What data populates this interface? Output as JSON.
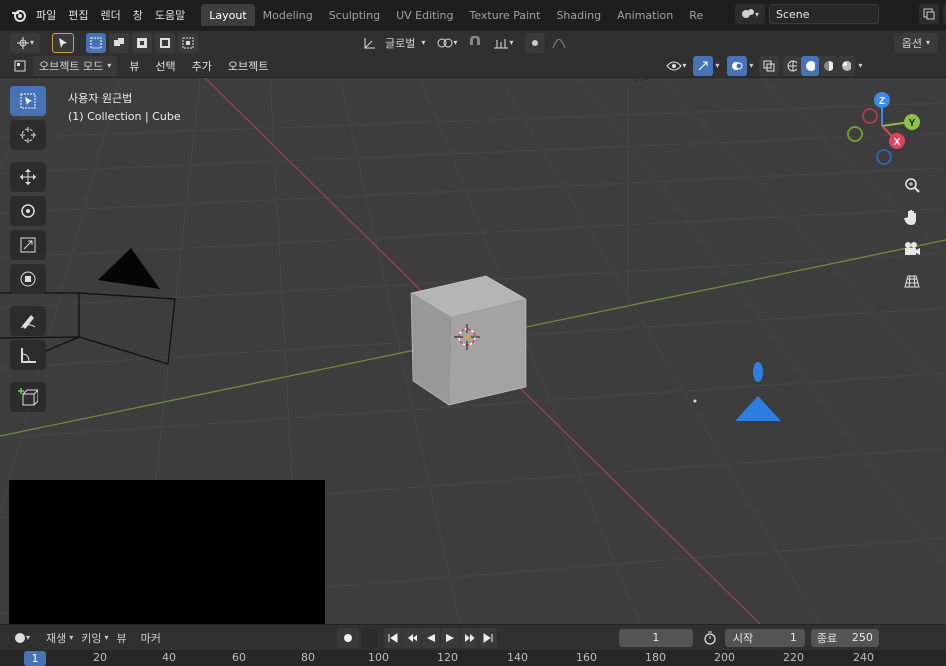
{
  "topbar": {
    "menus": [
      "파일",
      "편집",
      "렌더",
      "창",
      "도움말"
    ],
    "workspaces": [
      "Layout",
      "Modeling",
      "Sculpting",
      "UV Editing",
      "Texture Paint",
      "Shading",
      "Animation",
      "Re"
    ],
    "active_workspace": "Layout",
    "scene_name": "Scene"
  },
  "header": {
    "transform_orientation": "글로벌",
    "options_label": "옵션",
    "mode_label": "오브젝트 모드",
    "menus": [
      "뷰",
      "선택",
      "추가",
      "오브젝트"
    ]
  },
  "viewport": {
    "view_name": "사용자 원근법",
    "collection_label": "(1) Collection | Cube",
    "gizmo": {
      "z": "Z",
      "y": "Y",
      "x": "X"
    },
    "colors": {
      "x_axis": "#e0445a",
      "y_axis": "#8bc34a",
      "z_axis": "#3d8be8",
      "grid_bg": "#3d3d3d",
      "selected": "#4772b3"
    }
  },
  "timeline": {
    "menus": [
      "재생",
      "키잉",
      "뷰",
      "마커"
    ],
    "current_frame": "1",
    "start_label": "시작",
    "start_value": "1",
    "end_label": "종료",
    "end_value": "250",
    "ruler_ticks": [
      "1",
      "20",
      "40",
      "60",
      "80",
      "100",
      "120",
      "140",
      "160",
      "180",
      "200",
      "220",
      "240"
    ]
  },
  "icons": {
    "left_tools": [
      "select-box-icon",
      "cursor-icon",
      "move-icon",
      "rotate-icon",
      "scale-icon",
      "transform-icon",
      "annotate-icon",
      "measure-icon",
      "add-cube-icon"
    ],
    "nav": [
      "zoom-icon",
      "hand-pan-icon",
      "camera-view-icon",
      "ortho-grid-icon"
    ]
  }
}
